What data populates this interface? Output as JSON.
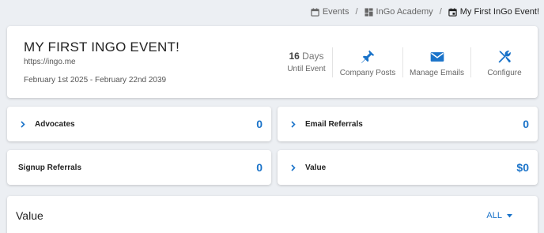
{
  "breadcrumb": {
    "items": [
      {
        "label": "Events"
      },
      {
        "label": "InGo Academy"
      },
      {
        "label": "My First InGo Event!"
      }
    ],
    "separator": "/"
  },
  "event": {
    "title": "MY FIRST INGO EVENT!",
    "url": "https://ingo.me",
    "dates": "February 1st 2025 - February 22nd 2039"
  },
  "countdown": {
    "number": "16",
    "unit": " Days",
    "label": "Until Event"
  },
  "actions": [
    {
      "label": "Company Posts",
      "icon": "pin-icon"
    },
    {
      "label": "Manage Emails",
      "icon": "envelope-icon"
    },
    {
      "label": "Configure",
      "icon": "wrench-screwdriver-icon"
    }
  ],
  "stats": [
    {
      "label": "Advocates",
      "value": "0",
      "expandable": true
    },
    {
      "label": "Email Referrals",
      "value": "0",
      "expandable": true
    },
    {
      "label": "Signup Referrals",
      "value": "0",
      "expandable": false
    },
    {
      "label": "Value",
      "value": "$0",
      "expandable": true
    }
  ],
  "value_section": {
    "title": "Value",
    "filter_label": "ALL"
  },
  "colors": {
    "accent": "#1a73c9",
    "background": "#eceff3",
    "card": "#ffffff"
  }
}
